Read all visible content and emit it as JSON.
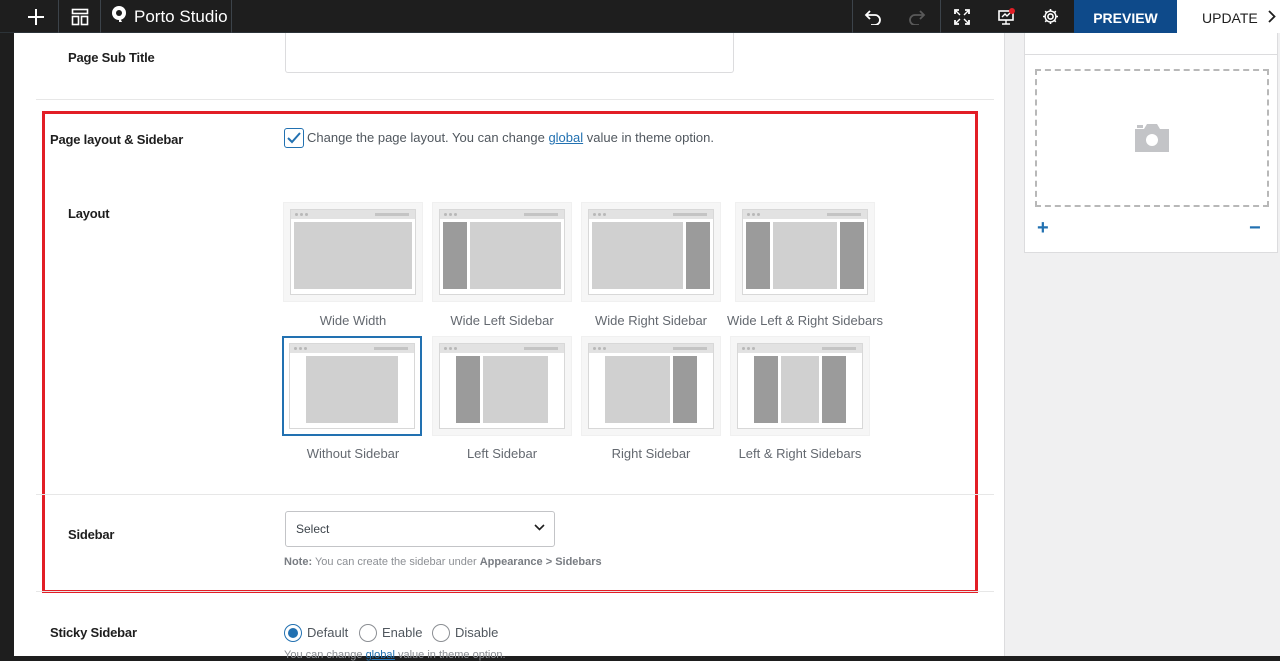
{
  "topbar": {
    "brand": "Porto Studio",
    "preview_label": "PREVIEW",
    "update_label": "UPDATE",
    "icons": [
      "plus-icon",
      "layout-icon",
      "porto-logo-icon",
      "undo-icon",
      "redo-icon",
      "fullscreen-icon",
      "presentation-icon",
      "settings-icon",
      "chevron-right-icon"
    ],
    "accent": "#0e4a8a"
  },
  "fields": {
    "page_sub_title_label": "Page Sub Title",
    "page_sub_title_value": "",
    "page_layout_label": "Page layout & Sidebar",
    "page_layout_checked": true,
    "page_layout_text_before": "Change the page layout. You can change ",
    "page_layout_link": "global",
    "page_layout_text_after": " value in theme option.",
    "layout_label": "Layout",
    "sidebar_label": "Sidebar",
    "sidebar_select_value": "Select",
    "sidebar_note_prefix": "Note:",
    "sidebar_note_text": " You can create the sidebar under ",
    "sidebar_note_path": "Appearance > Sidebars",
    "sticky_label": "Sticky Sidebar",
    "sticky_options": [
      "Default",
      "Enable",
      "Disable"
    ],
    "sticky_selected": "Default",
    "sticky_note_before": "You can change ",
    "sticky_note_link": "global",
    "sticky_note_after": " value in theme option."
  },
  "layouts": [
    {
      "caption": "Wide Width",
      "selected": false
    },
    {
      "caption": "Wide Left Sidebar",
      "selected": false
    },
    {
      "caption": "Wide Right Sidebar",
      "selected": false
    },
    {
      "caption": "Wide Left & Right Sidebars",
      "selected": false
    },
    {
      "caption": "Without Sidebar",
      "selected": true
    },
    {
      "caption": "Left Sidebar",
      "selected": false
    },
    {
      "caption": "Right Sidebar",
      "selected": false
    },
    {
      "caption": "Left & Right Sidebars",
      "selected": false
    }
  ],
  "side_panel": {
    "add_symbol": "+",
    "remove_symbol": "−",
    "image_icon": "camera-icon"
  },
  "colors": {
    "highlight": "#e21e26",
    "link": "#2271b1"
  }
}
